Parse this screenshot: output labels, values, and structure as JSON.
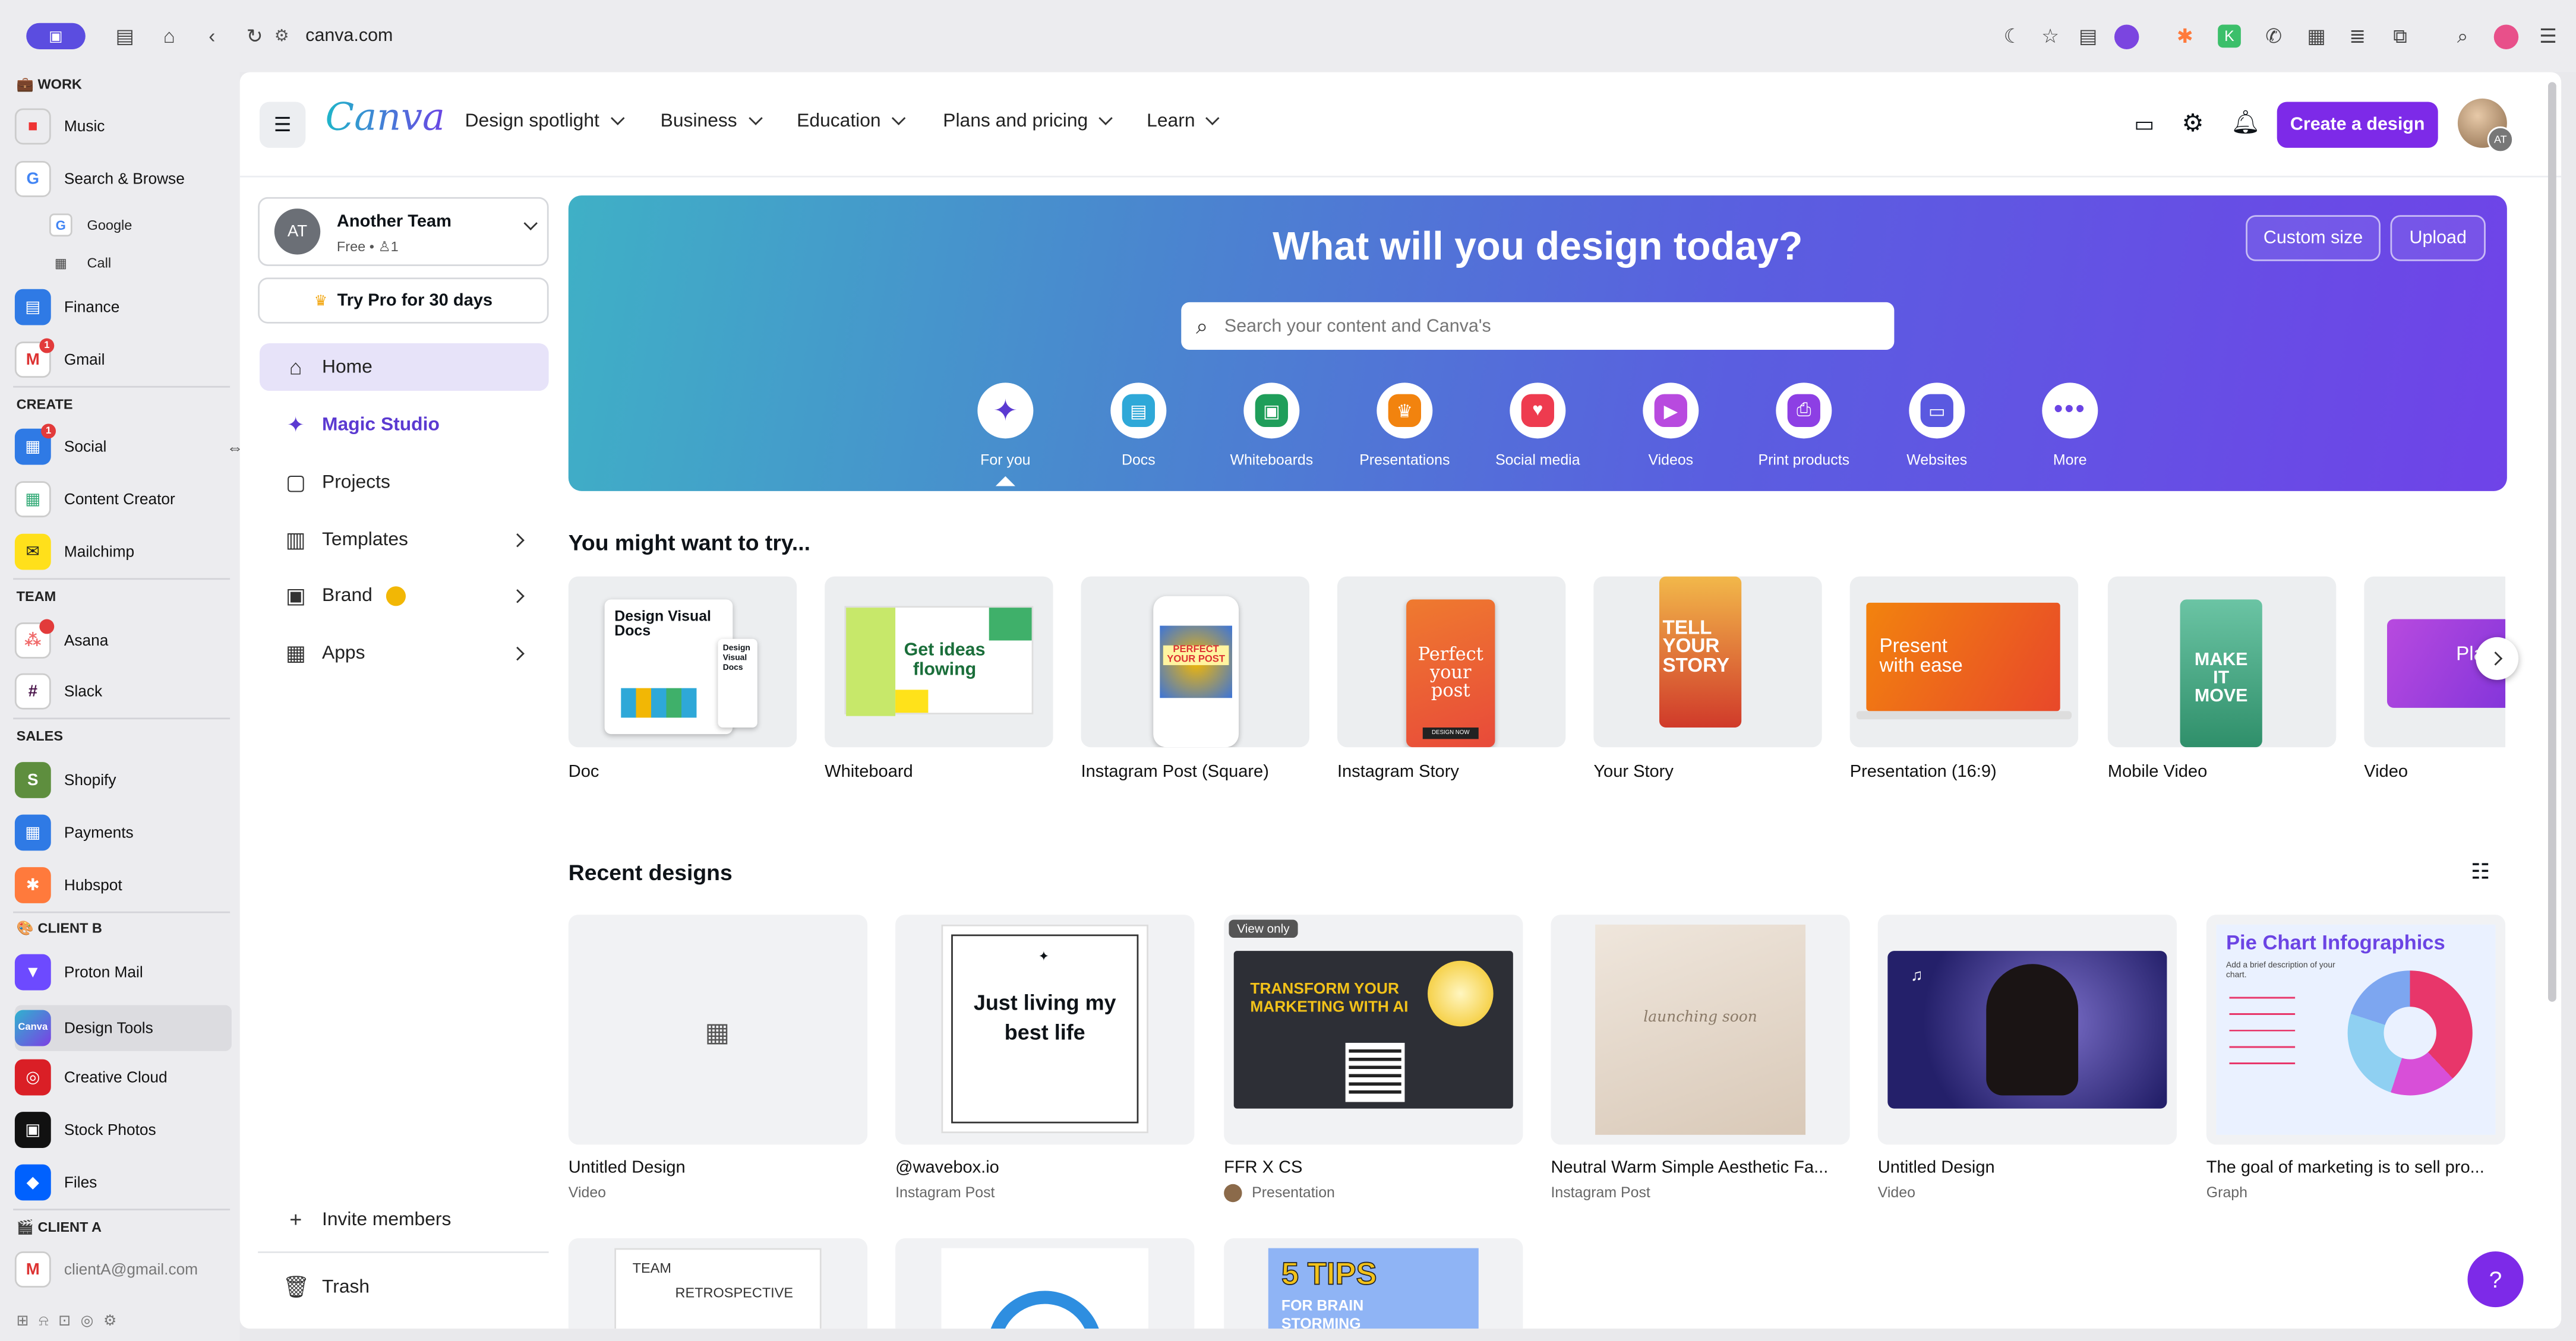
{
  "browser": {
    "url": "canva.com"
  },
  "sidebar": {
    "sections": {
      "work": "WORK",
      "create": "CREATE",
      "team": "TEAM",
      "sales": "SALES",
      "client_b": "CLIENT B",
      "client_a": "CLIENT A"
    },
    "items": {
      "music": "Music",
      "search_browse": "Search & Browse",
      "google": "Google",
      "call": "Call",
      "finance": "Finance",
      "gmail": "Gmail",
      "social": "Social",
      "content_creator": "Content Creator",
      "mailchimp": "Mailchimp",
      "asana": "Asana",
      "slack": "Slack",
      "shopify": "Shopify",
      "payments": "Payments",
      "hubspot": "Hubspot",
      "proton_mail": "Proton Mail",
      "design_tools": "Design Tools",
      "creative_cloud": "Creative Cloud",
      "stock_photos": "Stock Photos",
      "files": "Files",
      "client_a_email": "clientA@gmail.com"
    },
    "badges": {
      "gmail": "1",
      "social": "1"
    }
  },
  "canva": {
    "logo": "Canva",
    "nav": [
      "Design spotlight",
      "Business",
      "Education",
      "Plans and pricing",
      "Learn"
    ],
    "create_button": "Create a design",
    "avatar_initials": "AT",
    "team": {
      "initials": "AT",
      "name": "Another Team",
      "plan": "Free •",
      "members": "1"
    },
    "try_pro": "Try Pro for 30 days",
    "left_nav": {
      "home": "Home",
      "magic": "Magic Studio",
      "projects": "Projects",
      "templates": "Templates",
      "brand": "Brand",
      "apps": "Apps",
      "invite": "Invite members",
      "trash": "Trash"
    },
    "hero": {
      "title": "What will you design today?",
      "search_placeholder": "Search your content and Canva's",
      "custom_size": "Custom size",
      "upload": "Upload"
    },
    "categories": [
      "For you",
      "Docs",
      "Whiteboards",
      "Presentations",
      "Social media",
      "Videos",
      "Print products",
      "Websites",
      "More"
    ],
    "try_heading": "You might want to try...",
    "try_items": [
      "Doc",
      "Whiteboard",
      "Instagram Post (Square)",
      "Instagram Story",
      "Your Story",
      "Presentation (16:9)",
      "Mobile Video",
      "Video"
    ],
    "thumb_text": {
      "doc": "Design Visual Docs",
      "doc_small": "Design Visual Docs",
      "whiteboard": "Get ideas flowing",
      "post": "PERFECT YOUR POST",
      "story": "Perfect your post",
      "story_btn": "DESIGN NOW",
      "your_story": "TELL YOUR STORY",
      "presentation": "Present with ease",
      "mobile": "MAKE IT MOVE",
      "video": "Play vid"
    },
    "recent_heading": "Recent designs",
    "recent": [
      {
        "title": "Untitled Design",
        "type": "Video"
      },
      {
        "title": "@wavebox.io",
        "type": "Instagram Post"
      },
      {
        "title": "FFR X CS",
        "type": "Presentation"
      },
      {
        "title": "Neutral Warm Simple Aesthetic Fa...",
        "type": "Instagram Post"
      },
      {
        "title": "Untitled Design",
        "type": "Video"
      },
      {
        "title": "The goal of marketing is to sell pro...",
        "type": "Graph"
      }
    ],
    "recent_text": {
      "living": "Just living my best life",
      "view_only": "View only",
      "ffr": "TRANSFORM YOUR MARKETING WITH AI",
      "launching": "launching soon",
      "pie": "Pie Chart Infographics",
      "pie_sub": "Add a brief description of your chart.",
      "team_retro_1": "TEAM",
      "team_retro_2": "RETROSPECTIVE",
      "tips": "5 TIPS",
      "tips_sub": "FOR BRAIN STORMING"
    },
    "help": "?"
  }
}
